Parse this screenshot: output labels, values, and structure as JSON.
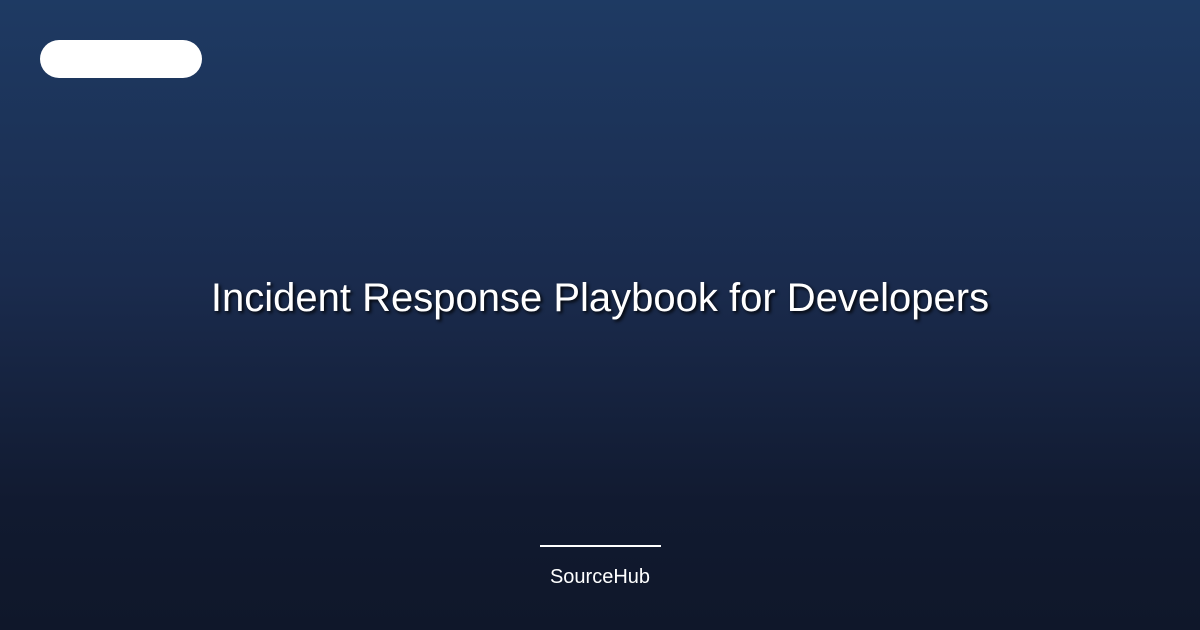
{
  "card": {
    "title": "Incident Response Playbook for Developers",
    "brand": "SourceHub",
    "colors": {
      "background_top": "#1e3a63",
      "background_bottom": "#0f172a",
      "text": "#ffffff",
      "pill": "#ffffff"
    }
  }
}
